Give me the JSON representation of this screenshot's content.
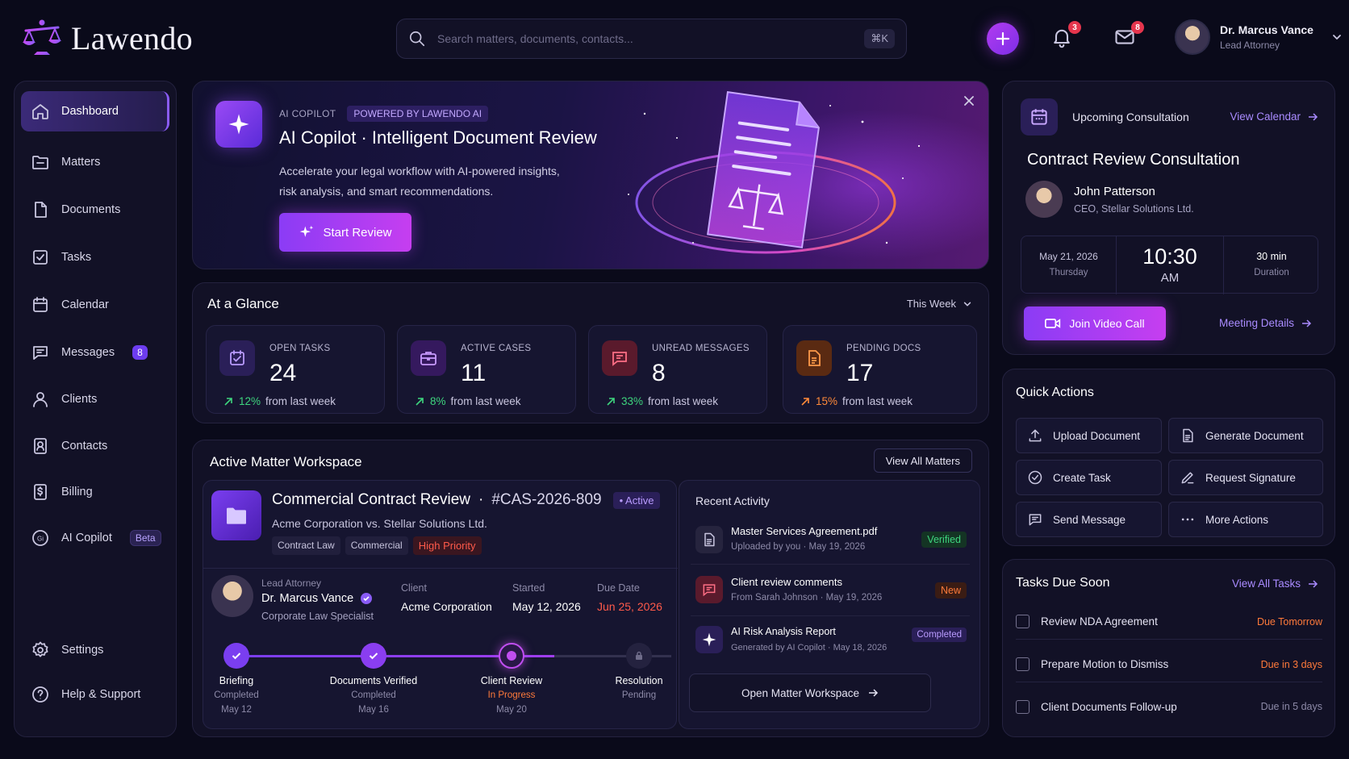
{
  "brand": {
    "name": "Lawendo"
  },
  "search": {
    "placeholder": "Search matters, documents, contacts...",
    "shortcut": "⌘K"
  },
  "header": {
    "notifications_count": "3",
    "messages_count": "8",
    "user": {
      "name": "Dr. Marcus Vance",
      "role": "Lead Attorney"
    }
  },
  "sidebar": {
    "items": [
      {
        "label": "Dashboard"
      },
      {
        "label": "Matters"
      },
      {
        "label": "Documents"
      },
      {
        "label": "Tasks"
      },
      {
        "label": "Calendar"
      },
      {
        "label": "Messages",
        "badge": "8"
      },
      {
        "label": "Clients"
      },
      {
        "label": "Contacts"
      },
      {
        "label": "Billing"
      },
      {
        "label": "AI Copilot",
        "badge": "Beta"
      }
    ],
    "footer": [
      {
        "label": "Settings"
      },
      {
        "label": "Help & Support"
      }
    ]
  },
  "hero": {
    "eyebrow": "AI COPILOT",
    "tag": "POWERED BY LAWENDO AI",
    "title": "AI Copilot · Intelligent Document Review",
    "desc_line1": "Accelerate your legal workflow with AI-powered insights,",
    "desc_line2": "risk analysis, and smart recommendations.",
    "cta": "Start Review"
  },
  "glance": {
    "title": "At a Glance",
    "period": "This Week",
    "stats": [
      {
        "label": "OPEN TASKS",
        "value": "24",
        "delta": "12%",
        "delta_text": "from last week",
        "accent": "#8a5cf6"
      },
      {
        "label": "ACTIVE CASES",
        "value": "11",
        "delta": "8%",
        "delta_text": "from last week",
        "accent": "#9b4ff0"
      },
      {
        "label": "UNREAD MESSAGES",
        "value": "8",
        "delta": "33%",
        "delta_text": "from last week",
        "accent": "#e5354d"
      },
      {
        "label": "PENDING DOCS",
        "value": "17",
        "delta": "15%",
        "delta_text": "from last week",
        "accent": "#f07a2a"
      }
    ]
  },
  "workspace": {
    "title": "Active Matter Workspace",
    "view_all": "View All Matters",
    "matter": {
      "name": "Commercial Contract Review",
      "id": "#CAS-2026-809",
      "status": "• Active",
      "parties": "Acme Corporation vs. Stellar Solutions Ltd.",
      "tags": [
        "Contract Law",
        "Commercial",
        "High Priority"
      ],
      "lead_label": "Lead Attorney",
      "lead_name": "Dr. Marcus Vance",
      "lead_spec": "Corporate Law Specialist",
      "client_label": "Client",
      "client": "Acme Corporation",
      "started_label": "Started",
      "started": "May 12, 2026",
      "due_label": "Due Date",
      "due": "Jun 25, 2026"
    },
    "steps": [
      {
        "name": "Briefing",
        "status": "Completed",
        "date": "May 12"
      },
      {
        "name": "Documents Verified",
        "status": "Completed",
        "date": "May 16"
      },
      {
        "name": "Client Review",
        "status": "In Progress",
        "date": "May 20"
      },
      {
        "name": "Resolution",
        "status": "Pending",
        "date": ""
      }
    ],
    "activity_title": "Recent Activity",
    "activity": [
      {
        "title": "Master Services Agreement.pdf",
        "sub": "Uploaded by you · May 19, 2026",
        "tag": "Verified"
      },
      {
        "title": "Client review comments",
        "sub": "From Sarah Johnson · May 19, 2026",
        "tag": "New"
      },
      {
        "title": "AI Risk Analysis Report",
        "sub": "Generated by AI Copilot · May 18, 2026",
        "tag": "Completed"
      }
    ],
    "open_btn": "Open Matter Workspace"
  },
  "consultation": {
    "label": "Upcoming Consultation",
    "calendar_link": "View Calendar",
    "title": "Contract Review Consultation",
    "person": "John Patterson",
    "person_role": "CEO, Stellar Solutions Ltd.",
    "date": "May 21, 2026",
    "day": "Thursday",
    "time": "10:30",
    "ampm": "AM",
    "duration": "30 min",
    "duration_label": "Duration",
    "join": "Join Video Call",
    "details": "Meeting Details"
  },
  "quick_actions": {
    "title": "Quick Actions",
    "items": [
      "Upload Document",
      "Generate Document",
      "Create Task",
      "Request Signature",
      "Send Message",
      "More Actions"
    ]
  },
  "tasks_due": {
    "title": "Tasks Due Soon",
    "link": "View All Tasks",
    "items": [
      {
        "name": "Review NDA Agreement",
        "due": "Due Tomorrow"
      },
      {
        "name": "Prepare Motion to Dismiss",
        "due": "Due in 3 days"
      },
      {
        "name": "Client Documents Follow-up",
        "due": "Due in 5 days"
      }
    ]
  }
}
